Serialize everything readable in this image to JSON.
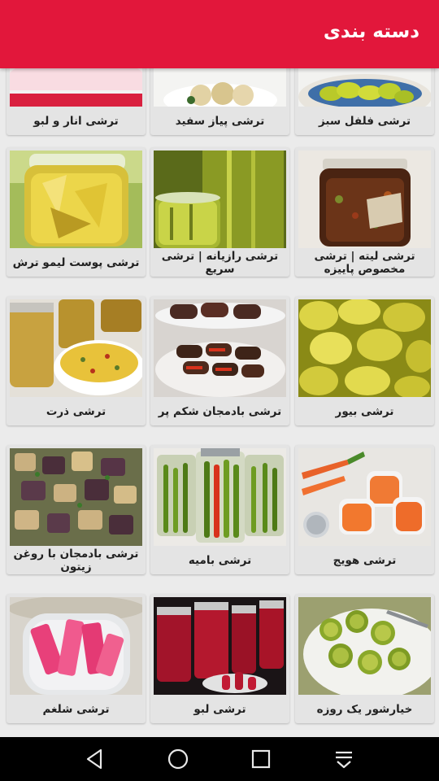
{
  "header": {
    "title": "دسته بندی"
  },
  "categories": [
    {
      "label": "ترشی فلفل سبز",
      "icon": "green-pepper-pickle-image"
    },
    {
      "label": "ترشی پیاز سفید",
      "icon": "white-onion-pickle-image"
    },
    {
      "label": "ترشی انار و لبو",
      "icon": "pomegranate-beet-pickle-image"
    },
    {
      "label": "ترشی لیته | ترشی مخصوص پاییزه",
      "icon": "liteh-pickle-image"
    },
    {
      "label": "ترشی رازیانه | ترشی سریع",
      "icon": "fennel-pickle-image"
    },
    {
      "label": "ترشی پوست لیمو ترش",
      "icon": "lemon-peel-pickle-image"
    },
    {
      "label": "ترشی بیور",
      "icon": "bell-pepper-pickle-image"
    },
    {
      "label": "ترشی بادمجان شکم پر",
      "icon": "stuffed-eggplant-pickle-image"
    },
    {
      "label": "ترشی ذرت",
      "icon": "corn-pickle-image"
    },
    {
      "label": "ترشی هویج",
      "icon": "carrot-pickle-image"
    },
    {
      "label": "ترشی بامیه",
      "icon": "okra-pickle-image"
    },
    {
      "label": "ترشی بادمجان با روغن زیتون",
      "icon": "eggplant-olive-oil-pickle-image"
    },
    {
      "label": "خیارشور یک روزه",
      "icon": "cucumber-pickle-image"
    },
    {
      "label": "ترشی لبو",
      "icon": "beet-pickle-image"
    },
    {
      "label": "ترشی شلغم",
      "icon": "turnip-pickle-image"
    }
  ],
  "navigation": {
    "back": "back-icon",
    "home": "home-icon",
    "recents": "recents-icon",
    "notifications": "notification-pulldown-icon"
  }
}
